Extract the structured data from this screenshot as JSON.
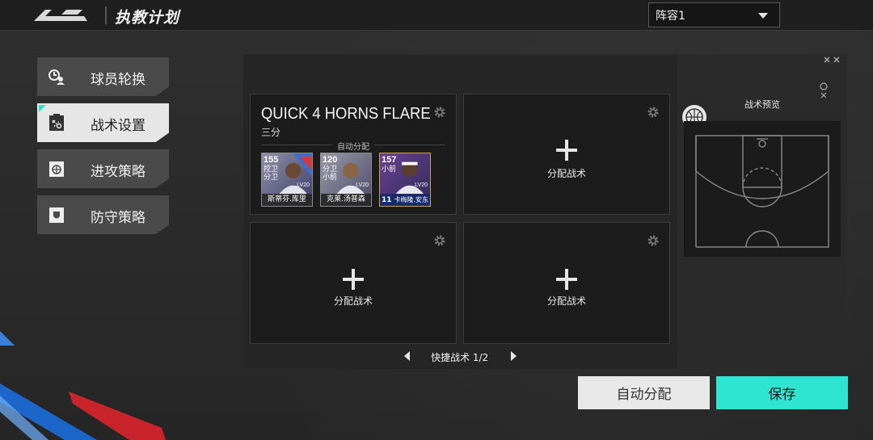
{
  "header": {
    "title": "执教计划",
    "lineup_select": {
      "value": "阵容1"
    }
  },
  "sidebar": {
    "items": [
      {
        "label": "球员轮换",
        "icon": "player-rotation-icon",
        "active": false
      },
      {
        "label": "战术设置",
        "icon": "tactics-board-icon",
        "active": true
      },
      {
        "label": "进攻策略",
        "icon": "offense-strategy-icon",
        "active": false
      },
      {
        "label": "防守策略",
        "icon": "defense-strategy-icon",
        "active": false
      }
    ]
  },
  "tactics": {
    "slots": [
      {
        "name": "QUICK 4 HORNS FLARE",
        "type": "三分",
        "auto_label": "自动分配",
        "players": [
          {
            "ovr": "155",
            "pos": "控卫 分卫",
            "level": "LV20",
            "name": "斯蒂芬.库里",
            "jersey": ""
          },
          {
            "ovr": "120",
            "pos": "分卫 小前",
            "level": "LV20",
            "name": "克莱.汤普森",
            "jersey": ""
          },
          {
            "ovr": "157",
            "pos": "小前",
            "level": "LV20",
            "name": "卡梅隆.安东尼",
            "jersey": "11"
          }
        ]
      },
      {
        "assign_label": "分配战术"
      },
      {
        "assign_label": "分配战术"
      },
      {
        "assign_label": "分配战术"
      }
    ],
    "pager_label": "快捷战术 1/2"
  },
  "preview": {
    "title": "战术预览"
  },
  "buttons": {
    "auto": "自动分配",
    "save": "保存"
  },
  "colors": {
    "accent": "#2de5d0",
    "active_tab": "#e6e6e6",
    "inactive_tab": "#4a4a4a"
  }
}
